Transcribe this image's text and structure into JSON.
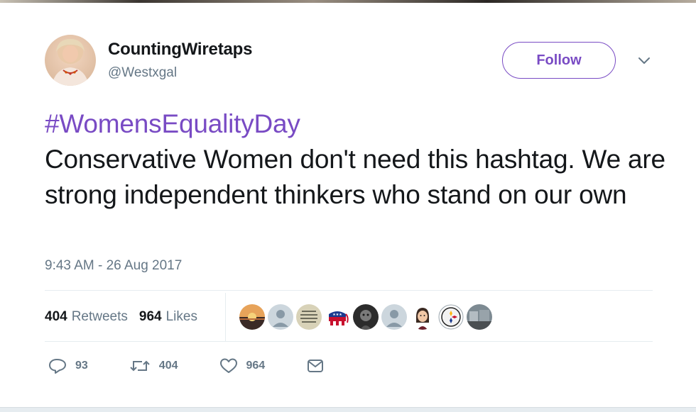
{
  "author": {
    "display_name": "CountingWiretaps",
    "handle": "@Westxgal"
  },
  "follow_label": "Follow",
  "tweet": {
    "hashtag": "#WomensEqualityDay",
    "body": "Conservative Women don't need this hashtag. We are strong independent thinkers who stand on our own",
    "timestamp": "9:43 AM - 26 Aug 2017"
  },
  "stats": {
    "retweets_count": "404",
    "retweets_label": "Retweets",
    "likes_count": "964",
    "likes_label": "Likes"
  },
  "actions": {
    "replies": "93",
    "retweets": "404",
    "likes": "964"
  },
  "colors": {
    "accent": "#794bc4",
    "muted": "#657786",
    "text": "#14171a"
  },
  "icons": [
    "chevron-down-icon",
    "reply-icon",
    "retweet-icon",
    "like-icon",
    "message-icon"
  ]
}
